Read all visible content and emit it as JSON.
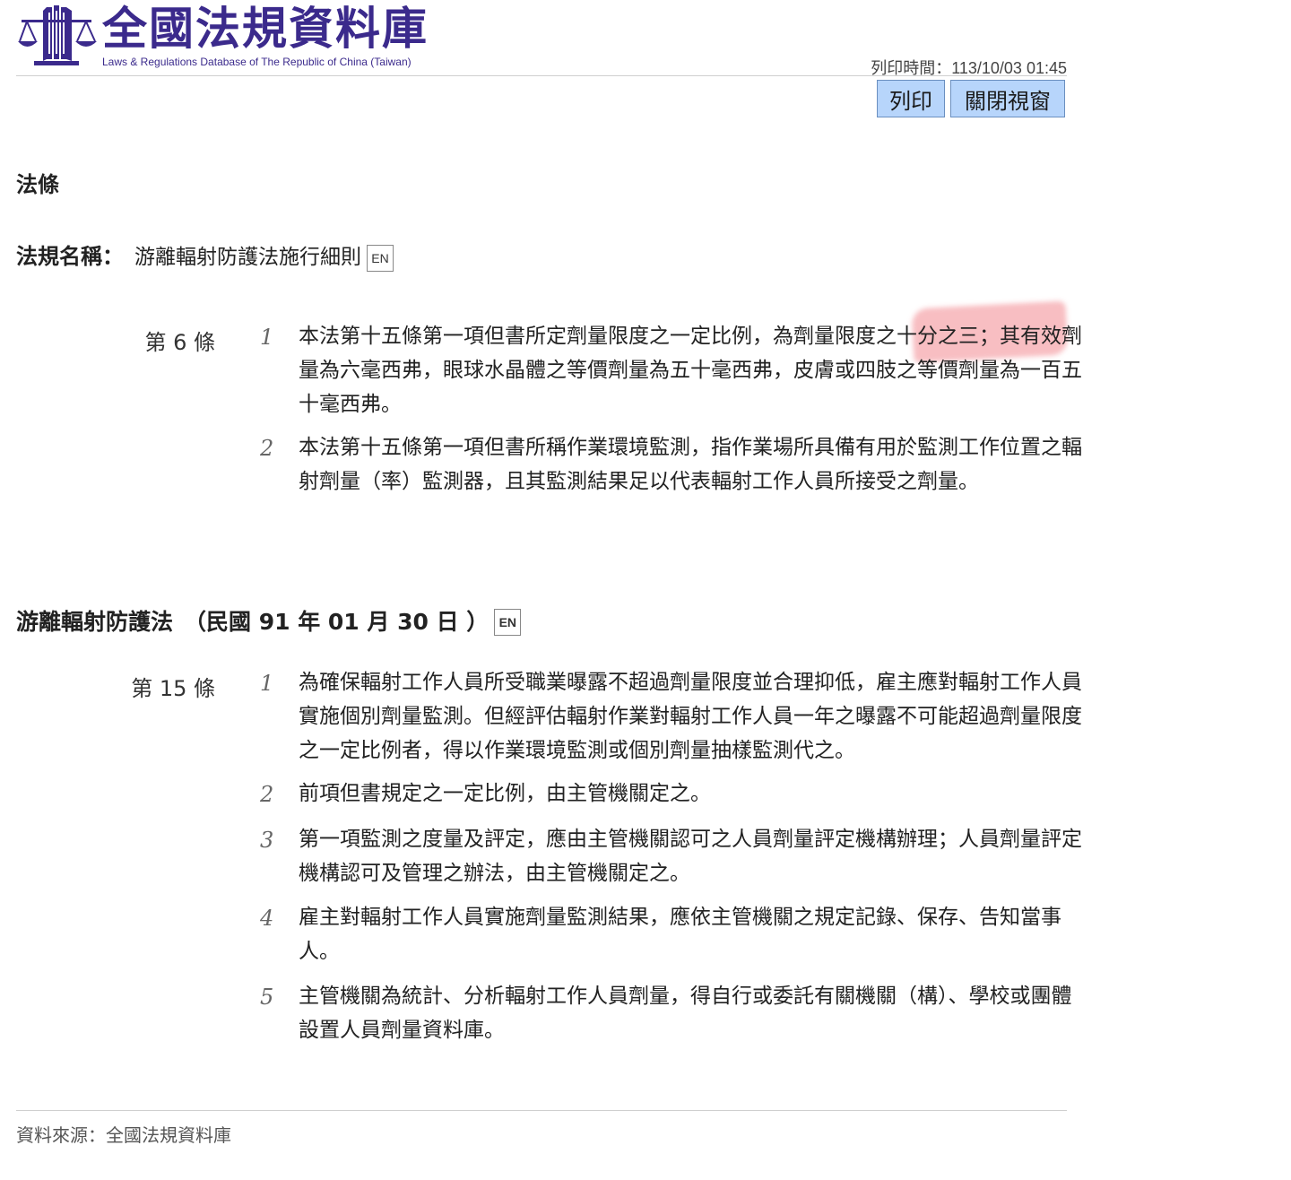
{
  "header": {
    "site_title": "全國法規資料庫",
    "site_subtitle": "Laws & Regulations Database of The Republic of China (Taiwan)",
    "print_time_label": "列印時間：",
    "print_time_value": "113/10/03 01:45",
    "print_button": "列印",
    "close_button": "關閉視窗"
  },
  "section_title": "法條",
  "law_name": {
    "label": "法規名稱：",
    "value": "游離輻射防護法施行細則",
    "en_tag": "EN"
  },
  "article_6": {
    "number": "第 6 條",
    "paragraphs": [
      {
        "index": "1",
        "text": "本法第十五條第一項但書所定劑量限度之一定比例，為劑量限度之十分之三；其有效劑量為六毫西弗，眼球水晶體之等價劑量為五十毫西弗，皮膚或四肢之等價劑量為一百五十毫西弗。"
      },
      {
        "index": "2",
        "text": "本法第十五條第一項但書所稱作業環境監測，指作業場所具備有用於監測工作位置之輻射劑量（率）監測器，且其監測結果足以代表輻射工作人員所接受之劑量。"
      }
    ]
  },
  "parent_law": {
    "name": "游離輻射防護法",
    "date": "（民國 91 年 01 月 30 日 ）",
    "en_tag": "EN"
  },
  "article_15": {
    "number": "第 15 條",
    "paragraphs": [
      {
        "index": "1",
        "text": "為確保輻射工作人員所受職業曝露不超過劑量限度並合理抑低，雇主應對輻射工作人員實施個別劑量監測。但經評估輻射作業對輻射工作人員一年之曝露不可能超過劑量限度之一定比例者，得以作業環境監測或個別劑量抽樣監測代之。"
      },
      {
        "index": "2",
        "text": "前項但書規定之一定比例，由主管機關定之。"
      },
      {
        "index": "3",
        "text": "第一項監測之度量及評定，應由主管機關認可之人員劑量評定機構辦理；人員劑量評定機構認可及管理之辦法，由主管機關定之。"
      },
      {
        "index": "4",
        "text": "雇主對輻射工作人員實施劑量監測結果，應依主管機關之規定記錄、保存、告知當事人。"
      },
      {
        "index": "5",
        "text": "主管機關為統計、分析輻射工作人員劑量，得自行或委託有關機關（構）、學校或團體設置人員劑量資料庫。"
      }
    ]
  },
  "footer": {
    "source": "資料來源：全國法規資料庫"
  },
  "colors": {
    "brand": "#3b2a8c",
    "button_bg": "#b7d5fb",
    "highlight": "#f06e78"
  }
}
